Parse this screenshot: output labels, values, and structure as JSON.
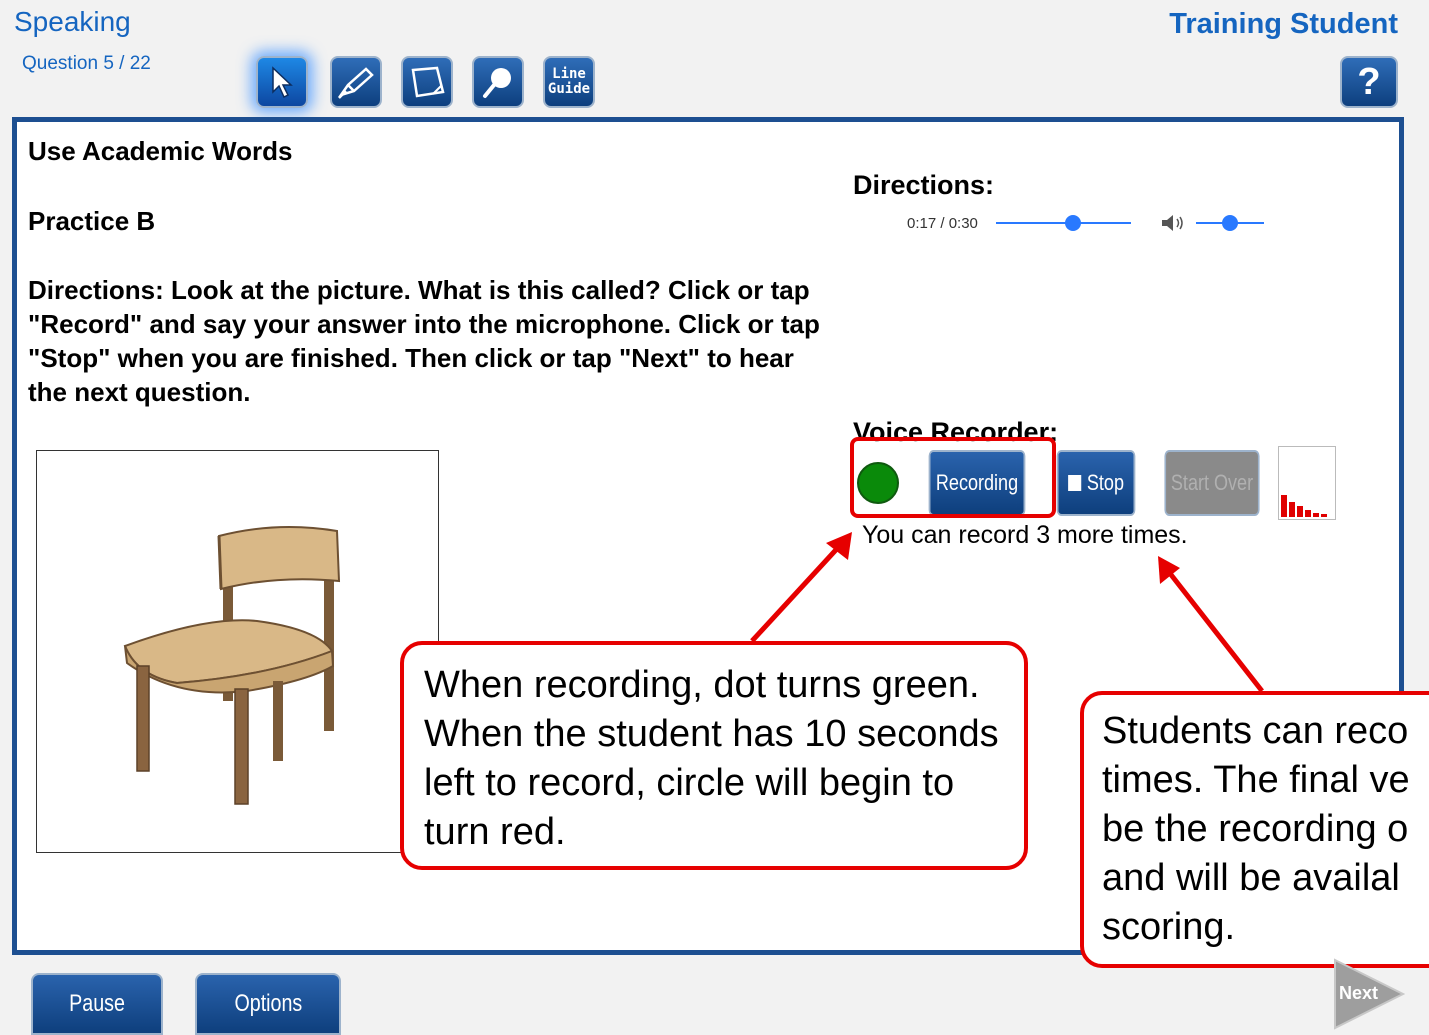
{
  "header": {
    "subject": "Speaking",
    "question_counter": "Question 5 / 22",
    "student_name": "Training Student",
    "help_label": "?"
  },
  "toolbar": {
    "tools": [
      {
        "name": "pointer-icon",
        "active": true
      },
      {
        "name": "highlighter-icon",
        "active": false
      },
      {
        "name": "notepad-icon",
        "active": false
      },
      {
        "name": "magnifier-icon",
        "active": false
      }
    ],
    "line_guide_label_1": "Line",
    "line_guide_label_2": "Guide"
  },
  "item": {
    "title": "Use Academic Words",
    "subtitle": "Practice B",
    "directions_text": "Directions: Look at the picture. What is this called? Click or tap \"Record\" and say your answer into the microphone. Click or tap \"Stop\" when you are finished. Then click or tap \"Next\" to hear the next question.",
    "picture_icon": "chair-illustration"
  },
  "directions_audio": {
    "heading": "Directions:",
    "time": "0:17 / 0:30",
    "progress": 0.567,
    "volume": 0.5
  },
  "voice_recorder": {
    "heading": "Voice Recorder:",
    "status_color": "#0a8a0a",
    "recording_label": "Recording",
    "stop_label": "Stop",
    "start_over_label": "Start Over",
    "remaining_text": "You can record 3 more times.",
    "meter_levels": [
      0.55,
      0.38,
      0.28,
      0.18,
      0.1,
      0.08
    ]
  },
  "callouts": {
    "recording_note": "When recording, dot turns green. When the student has 10 seconds left to record, circle will begin to turn red.",
    "rerecord_note_lines": [
      "Students can reco",
      "times. The final ve",
      "be the recording o",
      "and will be availal",
      "scoring."
    ]
  },
  "footer": {
    "pause_label": "Pause",
    "options_label": "Options",
    "next_label": "Next"
  },
  "colors": {
    "accent": "#1565c0",
    "panel_border": "#1d4f91",
    "callout_red": "#e60000"
  }
}
